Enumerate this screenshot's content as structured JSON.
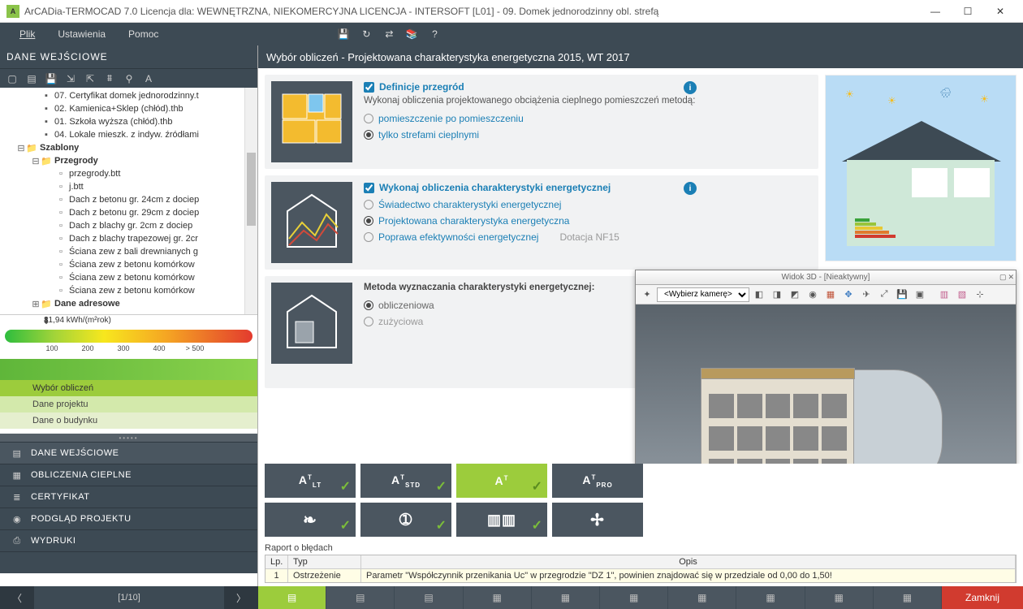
{
  "title": "ArCADia-TERMOCAD 7.0 Licencja dla: WEWNĘTRZNA, NIEKOMERCYJNA LICENCJA - INTERSOFT [L01] - 09. Domek jednorodzinny obl. strefą",
  "menu": {
    "file": "Plik",
    "settings": "Ustawienia",
    "help": "Pomoc"
  },
  "left": {
    "header": "DANE WEJŚCIOWE",
    "tree": [
      "07. Certyfikat domek jednorodzinny.t",
      "02. Kamienica+Sklep (chłód).thb",
      "01. Szkoła wyższa (chłód).thb",
      "04. Lokale mieszk. z indyw. źródłami"
    ],
    "szablony": "Szablony",
    "przegrody": "Przegrody",
    "items": [
      "przegrody.btt",
      "j.btt",
      "Dach z betonu gr. 24cm z dociep",
      "Dach z betonu gr. 29cm z dociep",
      "Dach z blachy gr. 2cm z dociep",
      "Dach z blachy trapezowej gr. 2cr",
      "Ściana zew z bali drewnianych g",
      "Ściana zew z betonu komórkow",
      "Ściana zew z betonu komórkow",
      "Ściana zew z betonu komórkow"
    ],
    "dane_adresowe": "Dane adresowe",
    "energy_value": "81,94 kWh/(m²rok)",
    "ticks": [
      "100",
      "200",
      "300",
      "400",
      "> 500"
    ],
    "opts": [
      "Wybór obliczeń",
      "Dane projektu",
      "Dane o budynku"
    ],
    "nav": [
      "DANE WEJŚCIOWE",
      "OBLICZENIA CIEPLNE",
      "CERTYFIKAT",
      "PODGLĄD PROJEKTU",
      "WYDRUKI"
    ]
  },
  "right": {
    "header": "Wybór obliczeń - Projektowana charakterystyka energetyczna 2015, WT 2017",
    "card1": {
      "heading": "Definicje przegród",
      "sub": "Wykonaj obliczenia projektowanego obciążenia cieplnego pomieszczeń metodą:",
      "r1": "pomieszczenie po pomieszczeniu",
      "r2": "tylko strefami cieplnymi"
    },
    "card2": {
      "heading": "Wykonaj obliczenia charakterystyki energetycznej",
      "r1": "Świadectwo charakterystyki energetycznej",
      "r2": "Projektowana charakterystyka energetyczna",
      "r3": "Poprawa efektywności energetycznej",
      "note": "Dotacja NF15"
    },
    "card3": {
      "heading": "Metoda wyznaczania charakterystyki energetycznej:",
      "r1": "obliczeniowa",
      "r2": "zużyciowa"
    },
    "viewer_title": "Widok 3D - [Nieaktywny]",
    "camera": "<Wybierz kamerę>",
    "buttons": {
      "lt": "LT",
      "std": "STD",
      "pro": "PRO"
    },
    "error_header": "Raport o błędach",
    "table": {
      "h1": "Lp.",
      "h2": "Typ",
      "h3": "Opis",
      "r1": "1",
      "r2": "Ostrzeżenie",
      "r3": "Parametr \"Współczynnik przenikania Uc\" w przegrodzie \"DZ 1\", powinien znajdować się w przedziale od 0,00 do 1,50!"
    }
  },
  "pager": "[1/10]",
  "close": "Zamknij"
}
